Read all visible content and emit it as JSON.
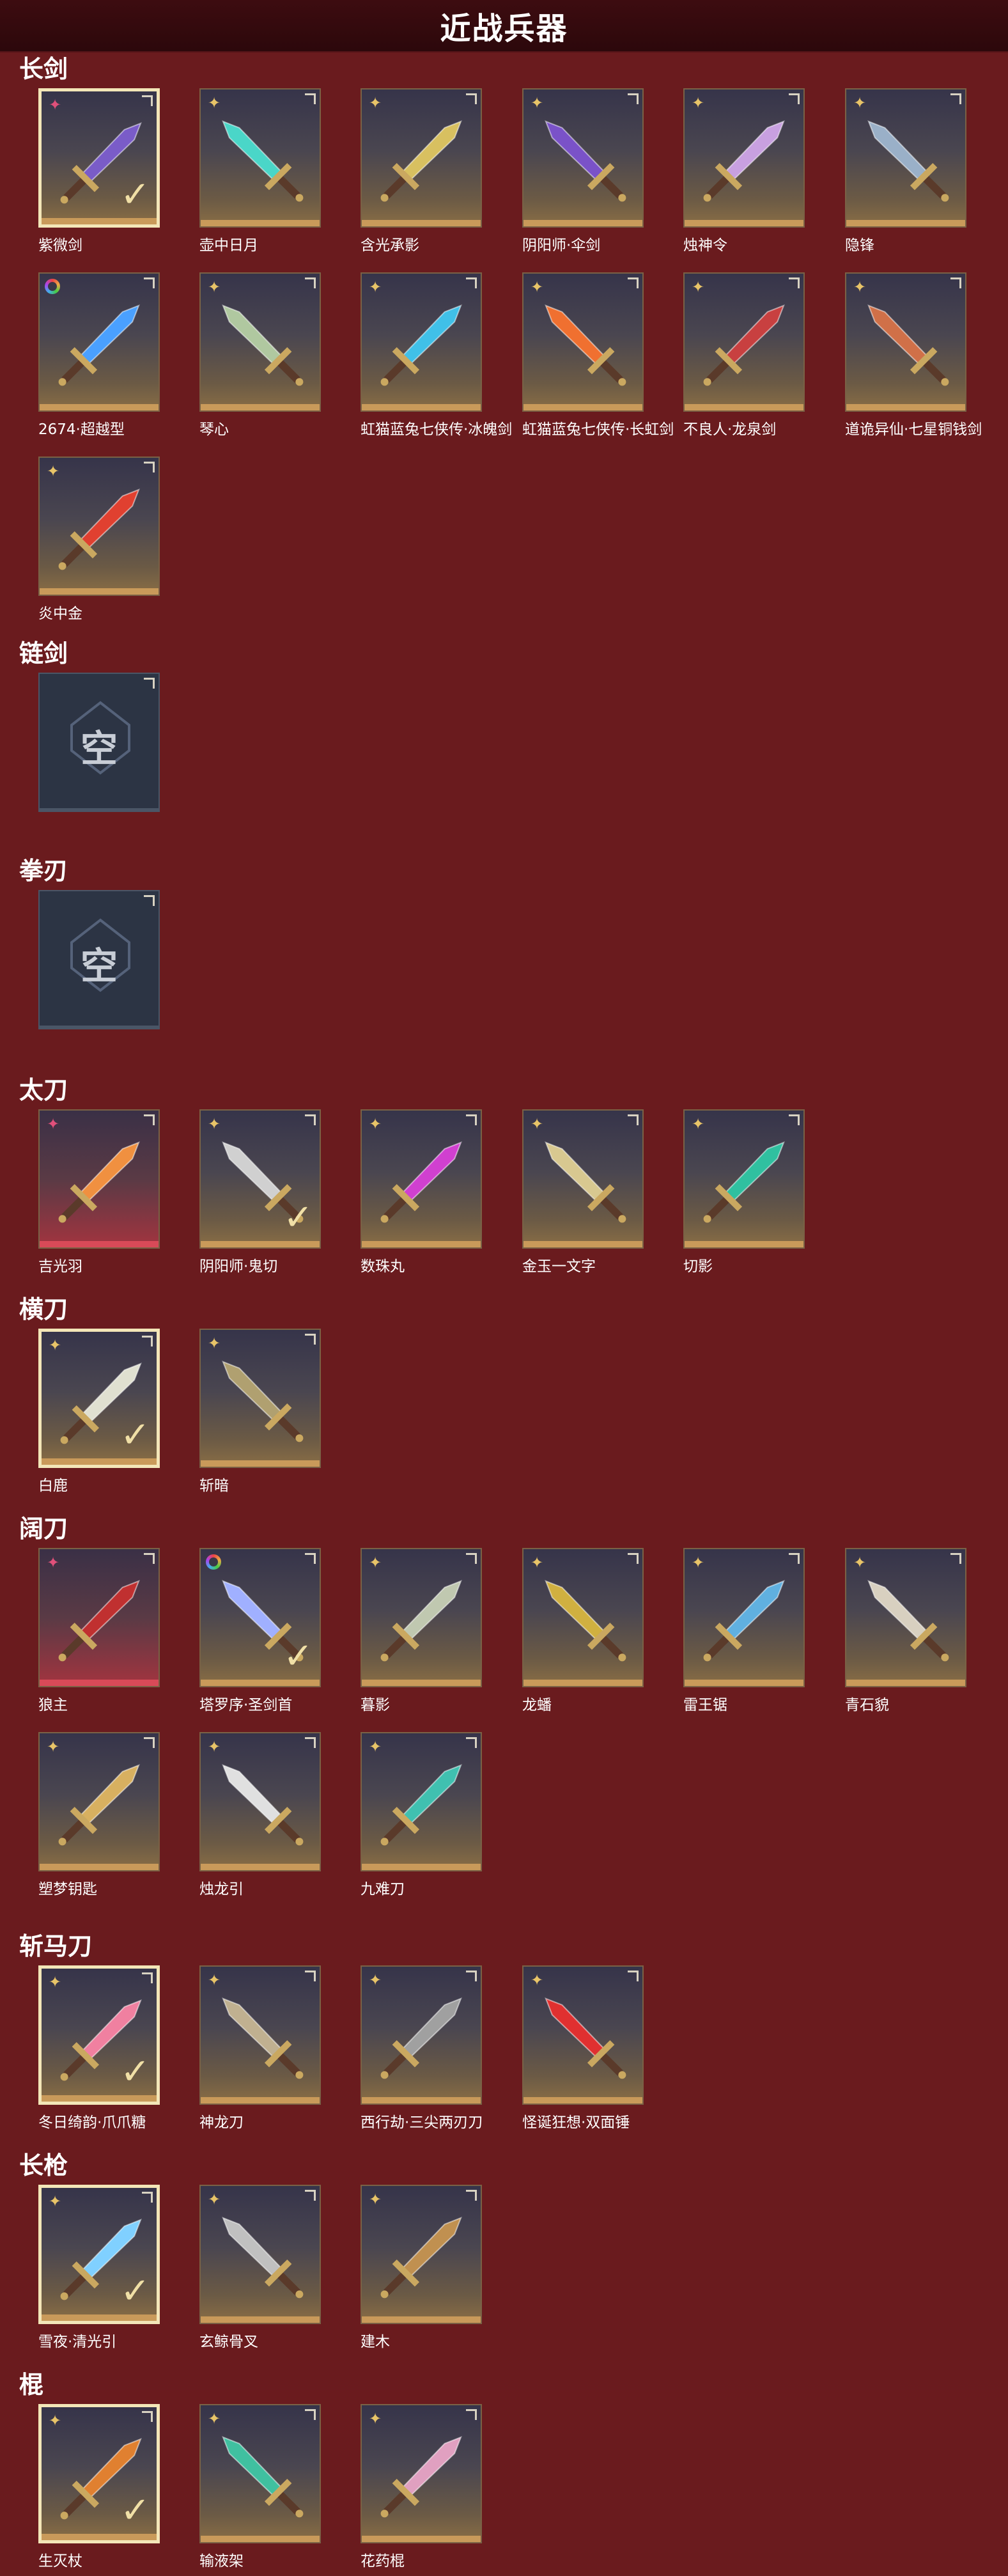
{
  "title": "近战兵器",
  "empty_label": "空",
  "sections": [
    {
      "name": "长剑",
      "items": [
        {
          "label": "紫微剑",
          "badge": "pink-star",
          "selected": true,
          "checked": true,
          "red": false,
          "color": "#7a5cc8"
        },
        {
          "label": "壶中日月",
          "badge": "gold-star",
          "color": "#4ad6c8"
        },
        {
          "label": "含光承影",
          "badge": "gold-star",
          "color": "#d8c060"
        },
        {
          "label": "阴阳师·伞剑",
          "badge": "gold-star",
          "color": "#7a52c8"
        },
        {
          "label": "烛神令",
          "badge": "gold-star",
          "color": "#c8a0e0"
        },
        {
          "label": "隐锋",
          "badge": "gold-star",
          "color": "#9ab0c8"
        },
        {
          "label": "2674·超越型",
          "badge": "rainbow",
          "color": "#4aa0ff"
        },
        {
          "label": "琴心",
          "badge": "gold-star",
          "color": "#b0c8a0"
        },
        {
          "label": "虹猫蓝兔七侠传·冰魄剑",
          "badge": "gold-star",
          "color": "#40c0e8"
        },
        {
          "label": "虹猫蓝兔七侠传·长虹剑",
          "badge": "gold-star",
          "color": "#f07030"
        },
        {
          "label": "不良人·龙泉剑",
          "badge": "gold-star",
          "color": "#c84040"
        },
        {
          "label": "道诡异仙·七星铜钱剑",
          "badge": "gold-star",
          "color": "#d07048"
        },
        {
          "label": "炎中金",
          "badge": "gold-star",
          "color": "#e04030"
        }
      ]
    },
    {
      "name": "链剑",
      "items": [
        {
          "empty": true
        }
      ]
    },
    {
      "name": "拳刃",
      "items": [
        {
          "empty": true
        }
      ]
    },
    {
      "name": "太刀",
      "items": [
        {
          "label": "吉光羽",
          "badge": "pink-star",
          "red": true,
          "color": "#f09040"
        },
        {
          "label": "阴阳师·鬼切",
          "badge": "gold-star",
          "checked": true,
          "color": "#d0d0d0"
        },
        {
          "label": "数珠丸",
          "badge": "gold-star",
          "color": "#d040d0"
        },
        {
          "label": "金玉一文字",
          "badge": "gold-star",
          "color": "#d8c890"
        },
        {
          "label": "切影",
          "badge": "gold-star",
          "color": "#30c0a0"
        }
      ]
    },
    {
      "name": "横刀",
      "items": [
        {
          "label": "白鹿",
          "badge": "gold-star",
          "selected": true,
          "checked": true,
          "color": "#e0e0d0"
        },
        {
          "label": "斩暗",
          "badge": "gold-star",
          "color": "#b0a070"
        }
      ]
    },
    {
      "name": "阔刀",
      "items": [
        {
          "label": "狼主",
          "badge": "pink-star",
          "red": true,
          "color": "#c03030"
        },
        {
          "label": "塔罗序·圣剑首",
          "badge": "rainbow",
          "checked": true,
          "color": "#a0b0ff"
        },
        {
          "label": "暮影",
          "badge": "gold-star",
          "color": "#c0c8b0"
        },
        {
          "label": "龙蟠",
          "badge": "gold-star",
          "color": "#d0b040"
        },
        {
          "label": "雷王锯",
          "badge": "gold-star",
          "color": "#60b0e0"
        },
        {
          "label": "青石貌",
          "badge": "gold-star",
          "color": "#d8d0c0"
        },
        {
          "label": "塑梦钥匙",
          "badge": "gold-star",
          "color": "#d8b060"
        },
        {
          "label": "烛龙引",
          "badge": "gold-star",
          "color": "#e0e0e0"
        },
        {
          "label": "九难刀",
          "badge": "gold-star",
          "color": "#40c0b0"
        }
      ]
    },
    {
      "name": "斩马刀",
      "items": [
        {
          "label": "冬日绮韵·爪爪糖",
          "badge": "gold-star",
          "selected": true,
          "checked": true,
          "color": "#f080a0"
        },
        {
          "label": "神龙刀",
          "badge": "gold-star",
          "color": "#c0b090"
        },
        {
          "label": "西行劫·三尖两刃刀",
          "badge": "gold-star",
          "color": "#a0a0a0"
        },
        {
          "label": "怪诞狂想·双面锤",
          "badge": "gold-star",
          "color": "#e03030"
        }
      ]
    },
    {
      "name": "长枪",
      "items": [
        {
          "label": "雪夜·清光引",
          "badge": "gold-star",
          "selected": true,
          "checked": true,
          "color": "#80d0ff"
        },
        {
          "label": "玄鲸骨叉",
          "badge": "gold-star",
          "color": "#c0c0c0"
        },
        {
          "label": "建木",
          "badge": "gold-star",
          "color": "#c09050"
        }
      ]
    },
    {
      "name": "棍",
      "items": [
        {
          "label": "生灭杖",
          "badge": "gold-star",
          "selected": true,
          "checked": true,
          "color": "#e08030"
        },
        {
          "label": "输液架",
          "badge": "gold-star",
          "color": "#40c0a0"
        },
        {
          "label": "花药棍",
          "badge": "gold-star",
          "color": "#e0a0c0"
        }
      ]
    }
  ]
}
